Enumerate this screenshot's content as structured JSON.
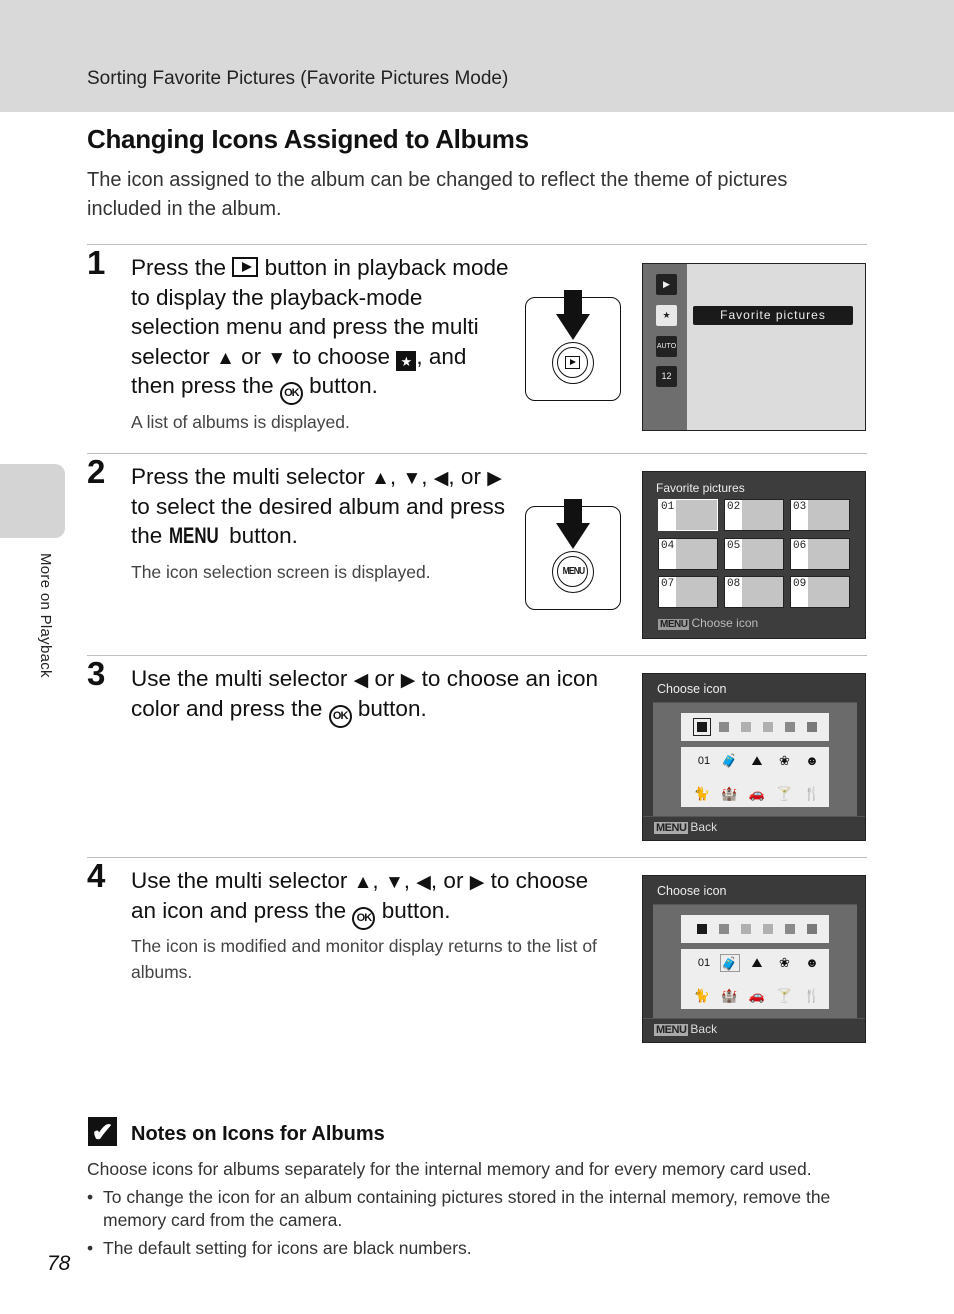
{
  "header": {
    "title": "Sorting Favorite Pictures (Favorite Pictures Mode)"
  },
  "side_tab": {
    "label": "More on Playback"
  },
  "page": {
    "title": "Changing Icons Assigned to Albums",
    "intro": "The icon assigned to the album can be changed to reflect the theme of pictures included in the album.",
    "page_number": "78"
  },
  "glyphs": {
    "up": "▲",
    "down": "▼",
    "left": "◀",
    "right": "▶",
    "fav_icon": "★",
    "ok_icon": "OK",
    "menu_word": "MENU"
  },
  "steps": [
    {
      "number": "1",
      "text_parts": [
        "Press the",
        "button in playback mode to display the playback-mode selection menu and press the multi selector",
        "or",
        "to choose",
        ", and then press the",
        "button."
      ],
      "note": "A list of albums is displayed.",
      "button_illustration": "playback-button"
    },
    {
      "number": "2",
      "text_parts": [
        "Press the multi selector",
        ",",
        ",",
        ", or",
        "to select the desired album and press the",
        "button."
      ],
      "note": "The icon selection screen is displayed.",
      "button_illustration": "menu-button"
    },
    {
      "number": "3",
      "text_parts": [
        "Use the multi selector",
        "or",
        "to choose an icon color and press the",
        "button."
      ],
      "note": ""
    },
    {
      "number": "4",
      "text_parts": [
        "Use the multi selector",
        ",",
        ",",
        ", or",
        "to choose an icon and press the",
        "button."
      ],
      "note": "The icon is modified and monitor display returns to the list of albums."
    }
  ],
  "screens": {
    "playback_menu": {
      "rail_icons": [
        "playback-icon",
        "favorite-pictures-icon",
        "auto-sort-icon",
        "list-by-date-icon"
      ],
      "rail_labels": [
        "▶",
        "★",
        "AUTO",
        "12"
      ],
      "selected_index": 1,
      "highlight_label": "Favorite pictures"
    },
    "album_list": {
      "title": "Favorite pictures",
      "albums": [
        "01",
        "02",
        "03",
        "04",
        "05",
        "06",
        "07",
        "08",
        "09"
      ],
      "selected": "01",
      "footer_chip": "MENU",
      "footer_label": "Choose icon"
    },
    "choose_icon_color": {
      "title": "Choose icon",
      "colors": [
        "#1a1a1a",
        "#8a8a8a",
        "#b0b0b0",
        "#b0b0b0",
        "#8a8a8a",
        "#7a7a7a"
      ],
      "selected_color_index": 0,
      "icons": [
        "01",
        "🧳",
        "⛰",
        "❀",
        "☻",
        "🐈",
        "🏰",
        "🚗",
        "🍸",
        "🍴"
      ],
      "icon_names": [
        "number-icon",
        "suitcase-icon",
        "mountain-icon",
        "flower-icon",
        "face-icon",
        "cat-icon",
        "castle-icon",
        "car-icon",
        "cocktail-icon",
        "cutlery-icon"
      ],
      "selected_icon_index": -1,
      "footer_chip": "MENU",
      "footer_label": "Back"
    },
    "choose_icon": {
      "title": "Choose icon",
      "selected_icon_index": 1,
      "footer_chip": "MENU",
      "footer_label": "Back"
    }
  },
  "notes": {
    "title": "Notes on Icons for Albums",
    "icon": "✔",
    "intro": "Choose icons for albums separately for the internal memory and for every memory card used.",
    "bullets": [
      "To change the icon for an album containing pictures stored in the internal memory, remove the memory card from the camera.",
      "The default setting for icons are black numbers."
    ]
  }
}
